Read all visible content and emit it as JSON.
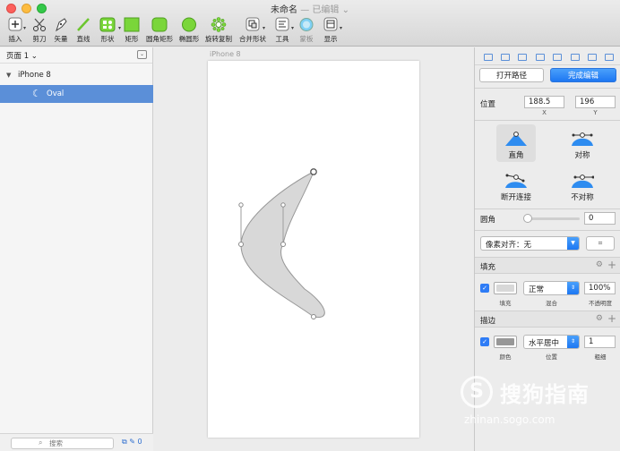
{
  "window": {
    "title": "未命名",
    "subtitle": "— 已编辑 ⌄"
  },
  "toolbar": {
    "items": [
      {
        "label": "插入",
        "icon": "plus-icon"
      },
      {
        "label": "剪刀",
        "icon": "scissors-icon"
      },
      {
        "label": "矢量",
        "icon": "pen-icon"
      },
      {
        "label": "直线",
        "icon": "line-icon"
      },
      {
        "label": "形状",
        "icon": "shapes-icon"
      },
      {
        "label": "矩形",
        "icon": "rectangle-icon"
      },
      {
        "label": "圆角矩形",
        "icon": "rounded-rectangle-icon"
      },
      {
        "label": "椭圆形",
        "icon": "oval-icon"
      },
      {
        "label": "旋转复制",
        "icon": "rotate-copy-icon"
      },
      {
        "label": "合并形状",
        "icon": "combine-shapes-icon"
      },
      {
        "label": "工具",
        "icon": "tools-icon"
      },
      {
        "label": "蒙板",
        "icon": "mask-icon"
      },
      {
        "label": "显示",
        "icon": "view-icon"
      }
    ]
  },
  "colors": {
    "accent": "#2e7cf6",
    "shape_fill": "#d8d8d8",
    "shape_stroke": "#979797",
    "selection": "#5b8fd8",
    "tool_green": "#7ad63a"
  },
  "layers": {
    "page": "页面 1 ⌄",
    "artboard": "iPhone 8",
    "layer": "Oval",
    "search_placeholder": "搜索",
    "edit_count": "0"
  },
  "canvas": {
    "artboard_label": "iPhone 8"
  },
  "inspector": {
    "open_path": "打开路径",
    "done_editing": "完成编辑",
    "position_label": "位置",
    "x_value": "188.5",
    "y_value": "196",
    "x_label": "X",
    "y_label": "Y",
    "point_types": [
      {
        "label": "直角"
      },
      {
        "label": "对称"
      },
      {
        "label": "断开连接"
      },
      {
        "label": "不对称"
      }
    ],
    "corner_label": "圆角",
    "corner_value": "0",
    "corner_slider_value": 0,
    "pixel_align": "像素对齐：无",
    "fill": {
      "title": "填充",
      "swatch_label": "填充",
      "blend_label": "混合",
      "blend": "正常",
      "opacity": "100%",
      "opacity_label": "不透明度",
      "color": "#d8d8d8"
    },
    "border": {
      "title": "描边",
      "swatch_label": "颜色",
      "position_label": "位置",
      "position": "水平居中",
      "width": "1",
      "width_label": "粗细",
      "color": "#979797"
    }
  },
  "watermark": {
    "logo": "S",
    "brand": "搜狗指南",
    "url": "zhinan.sogo.com"
  }
}
